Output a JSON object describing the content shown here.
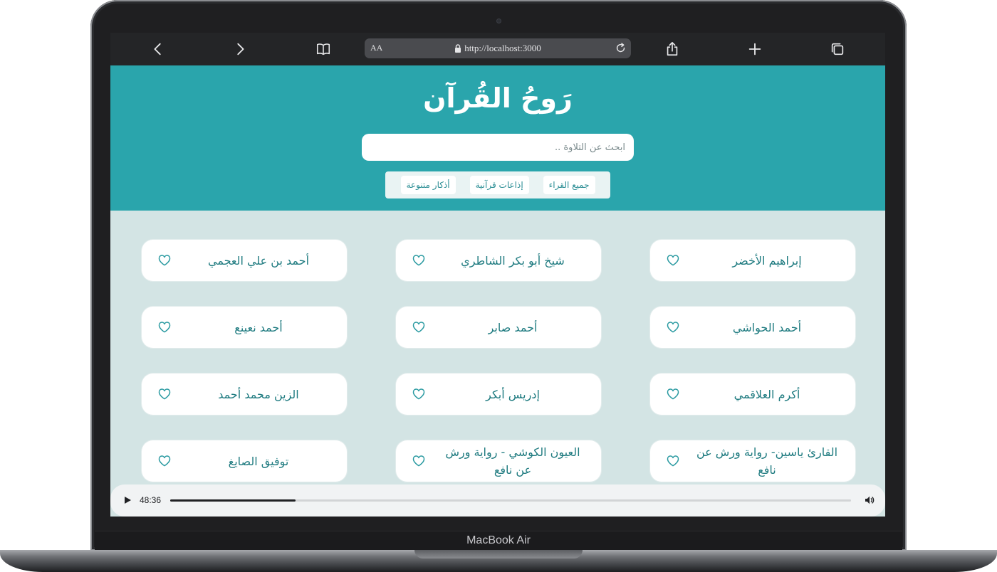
{
  "laptop": {
    "brand_label": "MacBook Air"
  },
  "browser": {
    "text_size_label": "AA",
    "url": "http://localhost:3000",
    "icons": [
      "back-arrow-icon",
      "forward-arrow-icon",
      "book-icon",
      "lock-icon",
      "reload-icon",
      "share-icon",
      "plus-icon",
      "tabs-icon"
    ]
  },
  "site": {
    "title": "رَوحُ القُرآن",
    "search_placeholder": "ابحث عن التلاوة ..",
    "filters": [
      "جميع القراء",
      "إذاعات قرآنية",
      "أذكار متنوعة"
    ]
  },
  "reciters": [
    "إبراهيم الأخضر",
    "شيخ أبو بكر الشاطري",
    "أحمد بن علي العجمي",
    "أحمد الحواشي",
    "أحمد صابر",
    "أحمد نعينع",
    "أكرم العلاقمي",
    "إدريس أبكر",
    "الزين محمد أحمد",
    "القارئ ياسين- رواية ورش عن نافع",
    "العيون الكوشي - رواية ورش عن نافع",
    "توفيق الصايغ"
  ],
  "player": {
    "time": "48:36",
    "progress_fraction": 0.184
  },
  "colors": {
    "header": "#2aa5ac",
    "content_bg": "#d3e4e4",
    "accent": "#2a8d94",
    "card_text": "#1f7b80"
  }
}
